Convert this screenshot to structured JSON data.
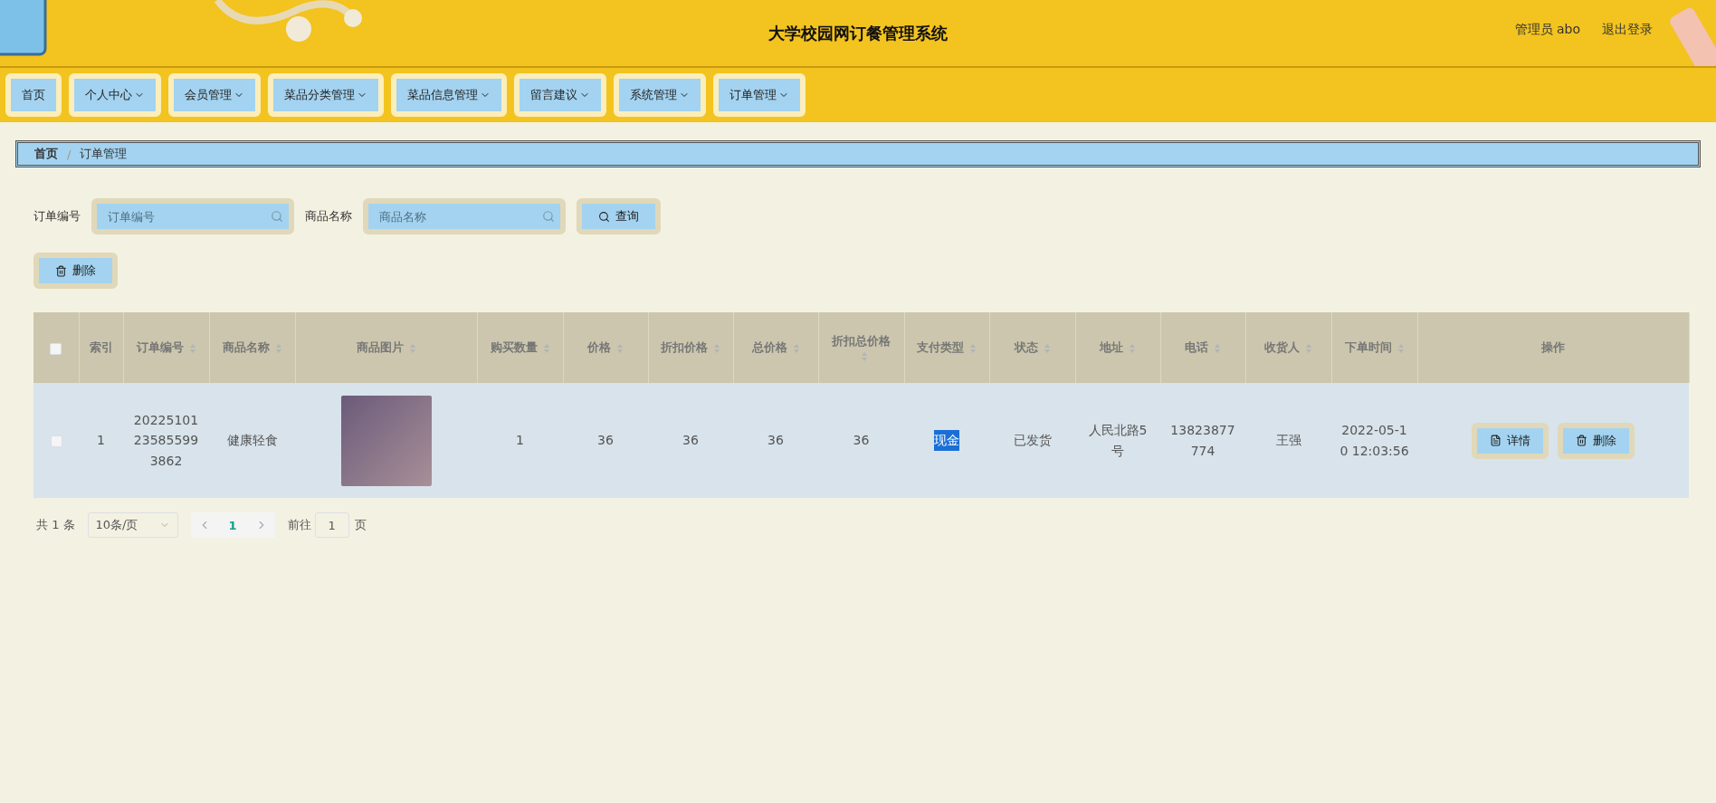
{
  "header": {
    "title": "大学校园网订餐管理系统",
    "user": "管理员 abo",
    "logout": "退出登录"
  },
  "nav": [
    {
      "label": "首页",
      "dropdown": false
    },
    {
      "label": "个人中心",
      "dropdown": true
    },
    {
      "label": "会员管理",
      "dropdown": true
    },
    {
      "label": "菜品分类管理",
      "dropdown": true
    },
    {
      "label": "菜品信息管理",
      "dropdown": true
    },
    {
      "label": "留言建议",
      "dropdown": true
    },
    {
      "label": "系统管理",
      "dropdown": true
    },
    {
      "label": "订单管理",
      "dropdown": true
    }
  ],
  "breadcrumb": {
    "items": [
      "首页",
      "订单管理"
    ],
    "separator": "/"
  },
  "search": {
    "fields": [
      {
        "label": "订单编号",
        "placeholder": "订单编号"
      },
      {
        "label": "商品名称",
        "placeholder": "商品名称"
      }
    ],
    "button": "查询"
  },
  "delete_button": "删除",
  "table": {
    "select_all_checked": false,
    "columns": [
      {
        "kind": "check"
      },
      {
        "label": "索引",
        "kind": "text",
        "sortable": false
      },
      {
        "label": "订单编号",
        "kind": "text",
        "sortable": true
      },
      {
        "label": "商品名称",
        "kind": "text",
        "sortable": true
      },
      {
        "label": "商品图片",
        "kind": "image",
        "sortable": true
      },
      {
        "label": "购买数量",
        "kind": "text",
        "sortable": true
      },
      {
        "label": "价格",
        "kind": "text",
        "sortable": true
      },
      {
        "label": "折扣价格",
        "kind": "text",
        "sortable": true
      },
      {
        "label": "总价格",
        "kind": "text",
        "sortable": true
      },
      {
        "label": "折扣总价格",
        "kind": "text",
        "sortable": true
      },
      {
        "label": "支付类型",
        "kind": "text",
        "sortable": true
      },
      {
        "label": "状态",
        "kind": "text",
        "sortable": true
      },
      {
        "label": "地址",
        "kind": "text",
        "sortable": true
      },
      {
        "label": "电话",
        "kind": "text",
        "sortable": true
      },
      {
        "label": "收货人",
        "kind": "text",
        "sortable": true
      },
      {
        "label": "下单时间",
        "kind": "text",
        "sortable": true
      },
      {
        "label": "操作",
        "kind": "actions",
        "sortable": false
      }
    ],
    "rows": [
      {
        "cells": [
          {
            "checked": false
          },
          {
            "text": "1",
            "highlighted": false
          },
          {
            "text": "20225101235855993862",
            "highlighted": false
          },
          {
            "text": "健康轻食",
            "highlighted": false
          },
          {},
          {
            "text": "1",
            "highlighted": false
          },
          {
            "text": "36",
            "highlighted": false
          },
          {
            "text": "36",
            "highlighted": false
          },
          {
            "text": "36",
            "highlighted": false
          },
          {
            "text": "36",
            "highlighted": false
          },
          {
            "text": "现金",
            "highlighted": true
          },
          {
            "text": "已发货",
            "highlighted": false
          },
          {
            "text": "人民北路5号",
            "highlighted": false
          },
          {
            "text": "13823877774",
            "highlighted": false
          },
          {
            "text": "王强",
            "highlighted": false
          },
          {
            "text": "2022-05-10 12:03:56",
            "highlighted": false
          },
          {
            "actions": [
              {
                "label": "详情",
                "kind": "detail"
              },
              {
                "label": "删除",
                "kind": "delete"
              }
            ]
          }
        ]
      }
    ]
  },
  "pagination": {
    "total": "共 1 条",
    "page_size": "10条/页",
    "pages": [
      {
        "label": "1",
        "selected": true
      }
    ],
    "goto_label": "前往",
    "goto_value": "1",
    "goto_suffix": "页"
  }
}
